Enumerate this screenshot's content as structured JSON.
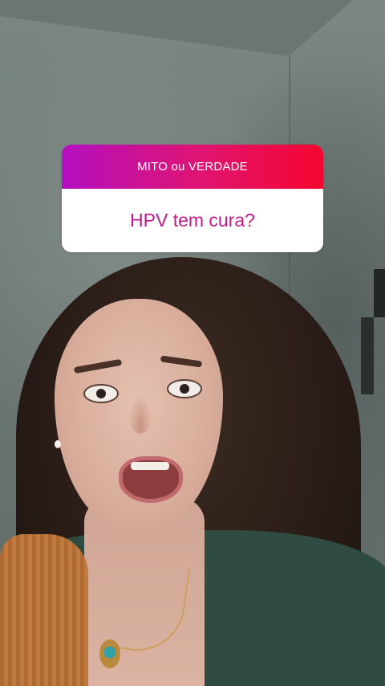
{
  "quiz_sticker": {
    "header": "MITO ou VERDADE",
    "question": "HPV tem cura?",
    "header_gradient": [
      "#b40fc0",
      "#e1146f",
      "#f5052f"
    ],
    "question_color": "#c21a8a"
  }
}
